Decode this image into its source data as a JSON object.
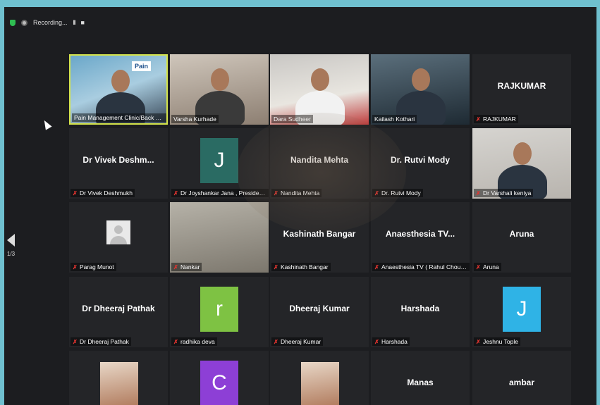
{
  "topbar": {
    "recording_label": "Recording...",
    "pause_glyph": "II",
    "stop_glyph": "■"
  },
  "pager": {
    "page": "1/3"
  },
  "tiles": [
    {
      "name_display": "",
      "label": "Pain Management Clinic/Back Pai...",
      "muted": false,
      "kind": "video",
      "logo": "Pain"
    },
    {
      "name_display": "",
      "label": "Varsha Kurhade",
      "muted": false,
      "kind": "video"
    },
    {
      "name_display": "",
      "label": "Dara Sudheer",
      "muted": false,
      "kind": "video"
    },
    {
      "name_display": "",
      "label": "Kailash Kothari",
      "muted": false,
      "kind": "video"
    },
    {
      "name_display": "RAJKUMAR",
      "label": "RAJKUMAR",
      "muted": true,
      "kind": "name"
    },
    {
      "name_display": "Dr Vivek Deshm...",
      "label": "Dr Vivek Deshmukh",
      "muted": true,
      "kind": "name"
    },
    {
      "name_display": "J",
      "label": "Dr Joyshankar Jana , Presiden...",
      "muted": true,
      "kind": "letter",
      "color": "#2a6b63"
    },
    {
      "name_display": "Nandita Mehta",
      "label": "Nandita Mehta",
      "muted": true,
      "kind": "name"
    },
    {
      "name_display": "Dr. Rutvi Mody",
      "label": "Dr. Rutvi Mody",
      "muted": true,
      "kind": "name"
    },
    {
      "name_display": "",
      "label": "Dr Varshali keniya",
      "muted": true,
      "kind": "video"
    },
    {
      "name_display": "",
      "label": "Parag Munot",
      "muted": true,
      "kind": "default"
    },
    {
      "name_display": "",
      "label": "Nankar",
      "muted": true,
      "kind": "video"
    },
    {
      "name_display": "Kashinath Bangar",
      "label": "Kashinath Bangar",
      "muted": true,
      "kind": "name"
    },
    {
      "name_display": "Anaesthesia TV...",
      "label": "Anaesthesia TV ( Rahul Choub...",
      "muted": true,
      "kind": "name"
    },
    {
      "name_display": "Aruna",
      "label": "Aruna",
      "muted": true,
      "kind": "name"
    },
    {
      "name_display": "Dr Dheeraj Pathak",
      "label": "Dr Dheeraj Pathak",
      "muted": true,
      "kind": "name"
    },
    {
      "name_display": "r",
      "label": "radhika deva",
      "muted": true,
      "kind": "letter",
      "color": "#7ec243"
    },
    {
      "name_display": "Dheeraj Kumar",
      "label": "Dheeraj Kumar",
      "muted": true,
      "kind": "name"
    },
    {
      "name_display": "Harshada",
      "label": "Harshada",
      "muted": true,
      "kind": "name"
    },
    {
      "name_display": "J",
      "label": "Jeshnu Tople",
      "muted": true,
      "kind": "letter",
      "color": "#2fb3e6"
    },
    {
      "name_display": "",
      "label": "",
      "muted": false,
      "kind": "photo"
    },
    {
      "name_display": "C",
      "label": "",
      "muted": false,
      "kind": "letter",
      "color": "#8d3fd6"
    },
    {
      "name_display": "",
      "label": "",
      "muted": false,
      "kind": "photo"
    },
    {
      "name_display": "Manas",
      "label": "",
      "muted": false,
      "kind": "name"
    },
    {
      "name_display": "ambar",
      "label": "",
      "muted": false,
      "kind": "name"
    }
  ]
}
